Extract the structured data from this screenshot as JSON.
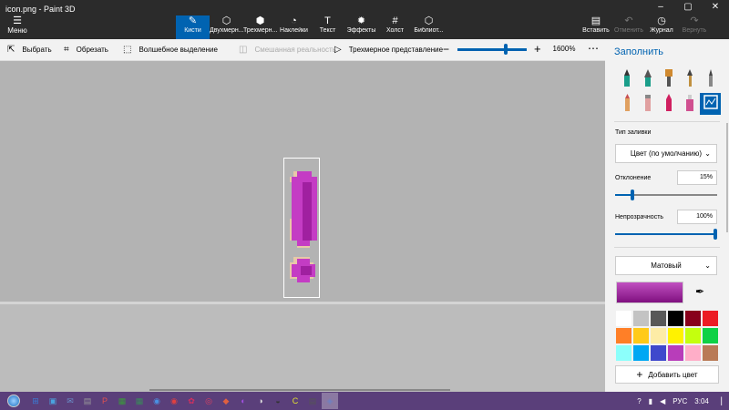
{
  "window": {
    "title": "icon.png - Paint 3D",
    "controls": [
      "–",
      "▢",
      "✕"
    ]
  },
  "menu": {
    "icon": "hamburger-icon",
    "label": "Меню"
  },
  "tools": [
    {
      "label": "Кисти",
      "icon": "brush-icon",
      "active": true
    },
    {
      "label": "Двухмерн...",
      "icon": "shapes2d-icon"
    },
    {
      "label": "Трехмерн...",
      "icon": "cube-icon"
    },
    {
      "label": "Наклейки",
      "icon": "sticker-icon"
    },
    {
      "label": "Текст",
      "icon": "text-icon"
    },
    {
      "label": "Эффекты",
      "icon": "effects-icon"
    },
    {
      "label": "Холст",
      "icon": "canvas-icon"
    },
    {
      "label": "Библиот...",
      "icon": "library-icon"
    }
  ],
  "right_tools": [
    {
      "label": "Вставить",
      "icon": "paste-icon",
      "enabled": true
    },
    {
      "label": "Отменить",
      "icon": "undo-icon",
      "enabled": false
    },
    {
      "label": "Журнал",
      "icon": "history-icon",
      "enabled": true
    },
    {
      "label": "Вернуть",
      "icon": "redo-icon",
      "enabled": false
    }
  ],
  "commands": {
    "select": "Выбрать",
    "crop": "Обрезать",
    "magic_select": "Волшебное выделение",
    "mixed_reality": "Смешанная реальность",
    "view_3d": "Трехмерное представление",
    "zoom": "1600%",
    "zoom_level": 0.66
  },
  "panel": {
    "title": "Заполнить",
    "fill_type_label": "Тип заливки",
    "fill_type_value": "Цвет (по умолчанию)",
    "tolerance_label": "Отклонение",
    "tolerance_value": "15%",
    "tolerance_fraction": 0.15,
    "opacity_label": "Непрозрачность",
    "opacity_value": "100%",
    "opacity_fraction": 1.0,
    "material_value": "Матовый",
    "add_color_label": "Добавить цвет",
    "selected_color": "#b040c0",
    "brushes_row1": [
      "marker-icon",
      "calligraphy-pen-icon",
      "oil-brush-icon",
      "watercolor-icon",
      "pixel-pen-icon"
    ],
    "brushes_row2": [
      "pencil-icon",
      "eraser-icon",
      "crayon-icon",
      "spray-can-icon",
      "fill-bucket-icon"
    ],
    "brush_colors_row1": [
      "#1a9e8a",
      "#1a9e8a",
      "#d08a30",
      "#c09040",
      "#888888"
    ],
    "brush_colors_row2": [
      "#c85050",
      "#e0a0a0",
      "#d02060",
      "#d05090",
      "#0063b1"
    ],
    "palette": [
      "#ffffff",
      "#c3c3c3",
      "#585858",
      "#000000",
      "#88001b",
      "#ec1c24",
      "#ff7f27",
      "#ffca18",
      "#fdeca6",
      "#fff200",
      "#c4ff0e",
      "#0ed145",
      "#8cfffb",
      "#00a8f3",
      "#3f48cc",
      "#b83dba",
      "#ffaec8",
      "#b97a56"
    ]
  },
  "taskbar": {
    "apps": [
      "⊞",
      "▣",
      "✉",
      "▤",
      "P",
      "▦",
      "▦",
      "◉",
      "◉",
      "✿",
      "◎",
      "◆",
      "◐",
      "◑",
      "◒",
      "C",
      "▤",
      "◈"
    ],
    "lang": "РУС",
    "time": "3:04"
  }
}
